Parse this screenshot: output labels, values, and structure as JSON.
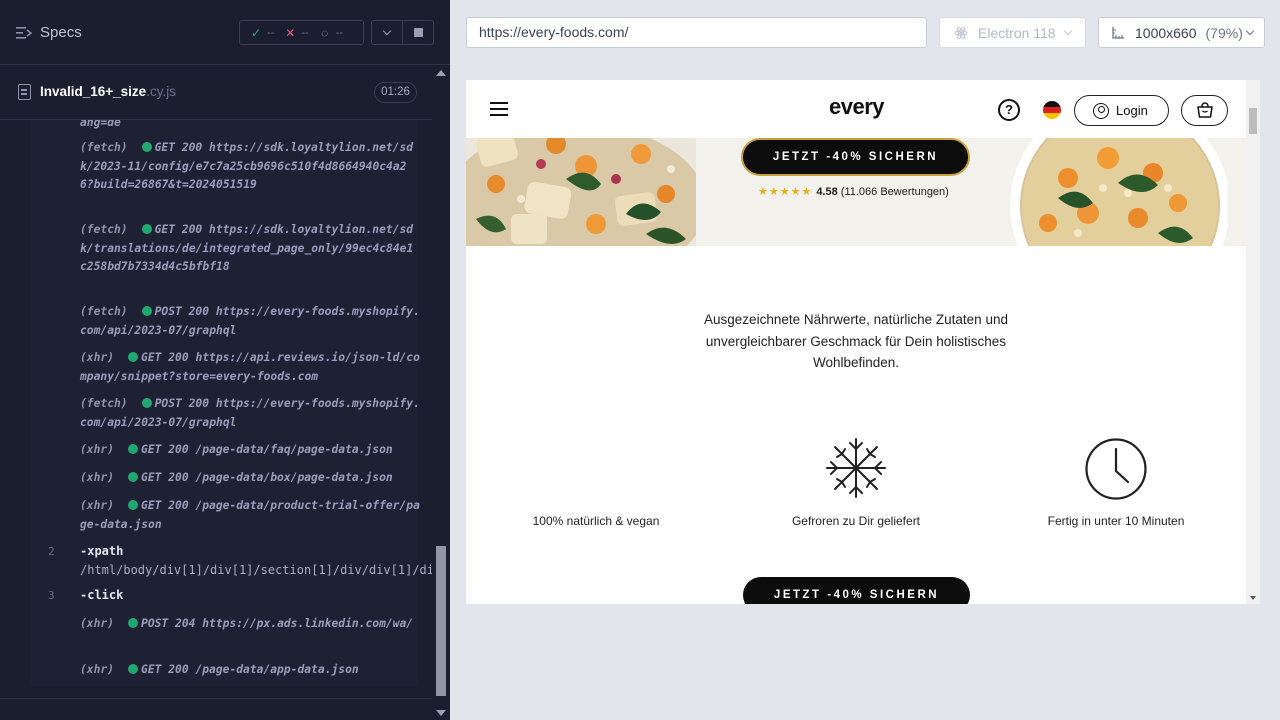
{
  "runner": {
    "specs_label": "Specs",
    "stats": {
      "passed": "--",
      "failed": "--",
      "pending": "--"
    },
    "spec": {
      "name": "Invalid_16+_size",
      "ext": ".cy.js",
      "duration": "01:26"
    }
  },
  "log": {
    "lines": [
      {
        "text": "ang=de"
      },
      {
        "type": "(fetch)",
        "status": "GET 200",
        "url": "https://sdk.loyaltylion.net/sdk/2023-11/config/e7c7a25cb9696c510f4d8664940c4a26?build=26867&t=2024051519"
      },
      {
        "type": "(fetch)",
        "status": "GET 200",
        "url": "https://sdk.loyaltylion.net/sdk/translations/de/integrated_page_only/99ec4c84e1c258bd7b7334d4c5bfbf18"
      },
      {
        "type": "(fetch)",
        "status": "POST 200",
        "url": "https://every-foods.myshopify.com/api/2023-07/graphql"
      },
      {
        "type": "(xhr)",
        "status": "GET 200",
        "url": "https://api.reviews.io/json-ld/company/snippet?store=every-foods.com"
      },
      {
        "type": "(fetch)",
        "status": "POST 200",
        "url": "https://every-foods.myshopify.com/api/2023-07/graphql"
      },
      {
        "type": "(xhr)",
        "status": "GET 200",
        "url": "/page-data/faq/page-data.json"
      },
      {
        "type": "(xhr)",
        "status": "GET 200",
        "url": "/page-data/box/page-data.json"
      },
      {
        "type": "(xhr)",
        "status": "GET 200",
        "url": "/page-data/product-trial-offer/page-data.json"
      },
      {
        "type": "(xhr)",
        "status": "POST 204",
        "url": "https://px.ads.linkedin.com/wa/"
      },
      {
        "type": "(xhr)",
        "status": "GET 200",
        "url": "/page-data/app-data.json"
      }
    ],
    "commands": [
      {
        "num": "2",
        "name": "-xpath",
        "arg": "/html/body/div[1]/div[1]/section[1]/div/div[1]/div/div/a"
      },
      {
        "num": "3",
        "name": "-click",
        "arg": ""
      }
    ]
  },
  "browser": {
    "url": "https://every-foods.com/",
    "name": "Electron 118",
    "viewport": "1000x660",
    "zoom": "(79%)"
  },
  "site": {
    "logo": "every",
    "help": "?",
    "login": "Login",
    "hero_cta": "JETZT -40% SICHERN",
    "rating_stars": "★★★★★",
    "rating_value": "4.58",
    "rating_count": "(11.066 Bewertungen)",
    "description": "Ausgezeichnete Nährwerte, natürliche Zutaten und unvergleichbarer Geschmack für Dein holistisches Wohlbefinden.",
    "features": [
      {
        "label": "100% natürlich & vegan",
        "icon": "leaf-icon"
      },
      {
        "label": "Gefroren zu Dir geliefert",
        "icon": "snowflake-icon"
      },
      {
        "label": "Fertig in unter 10 Minuten",
        "icon": "clock-icon"
      }
    ],
    "cta": "JETZT -40% SICHERN"
  }
}
